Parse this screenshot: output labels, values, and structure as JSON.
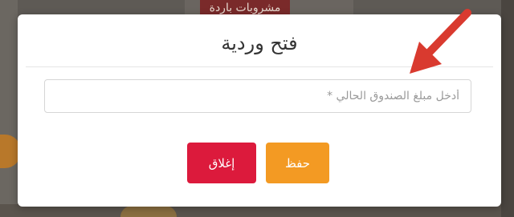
{
  "background": {
    "tag_label": "مشروبات باردة"
  },
  "modal": {
    "title": "فتح وردية",
    "amount_placeholder": "أدخل مبلغ الصندوق الحالي *",
    "amount_value": "",
    "save_label": "حفظ",
    "close_label": "إغلاق"
  },
  "colors": {
    "save_button": "#f39a23",
    "close_button": "#dc1a3c",
    "arrow": "#d93a2f"
  },
  "annotation": {
    "icon": "red-pointer-arrow-icon"
  }
}
